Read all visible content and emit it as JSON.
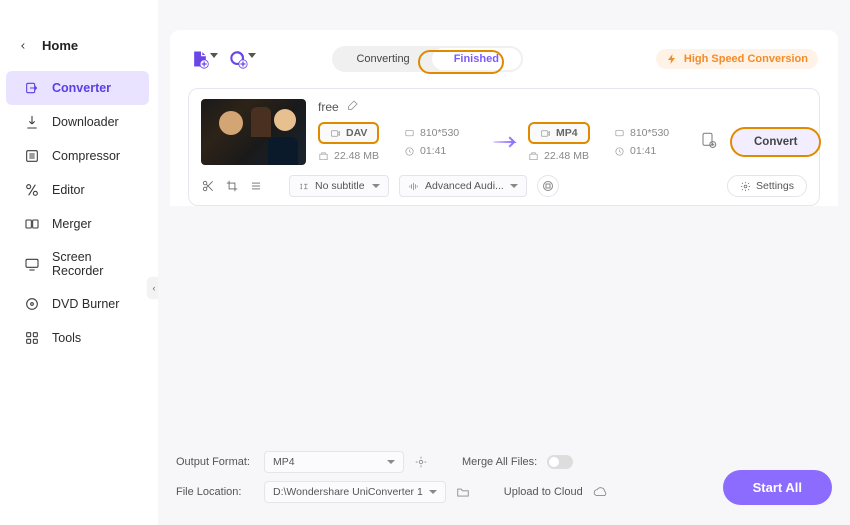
{
  "titlebar": {
    "avatar": "user"
  },
  "sidebar": {
    "home_label": "Home",
    "items": [
      {
        "label": "Converter"
      },
      {
        "label": "Downloader"
      },
      {
        "label": "Compressor"
      },
      {
        "label": "Editor"
      },
      {
        "label": "Merger"
      },
      {
        "label": "Screen Recorder"
      },
      {
        "label": "DVD Burner"
      },
      {
        "label": "Tools"
      }
    ]
  },
  "topbar": {
    "tabs": {
      "converting": "Converting",
      "finished": "Finished"
    },
    "high_speed": "High Speed Conversion"
  },
  "file": {
    "name": "free",
    "src": {
      "format": "DAV",
      "res": "810*530",
      "size": "22.48 MB",
      "dur": "01:41"
    },
    "dst": {
      "format": "MP4",
      "res": "810*530",
      "size": "22.48 MB",
      "dur": "01:41"
    },
    "convert_label": "Convert",
    "subtitle": "No subtitle",
    "audio": "Advanced Audi...",
    "settings": "Settings"
  },
  "footer": {
    "output_format_label": "Output Format:",
    "output_format_value": "MP4",
    "file_location_label": "File Location:",
    "file_location_value": "D:\\Wondershare UniConverter 1",
    "merge_label": "Merge All Files:",
    "upload_label": "Upload to Cloud",
    "start_all": "Start All"
  }
}
